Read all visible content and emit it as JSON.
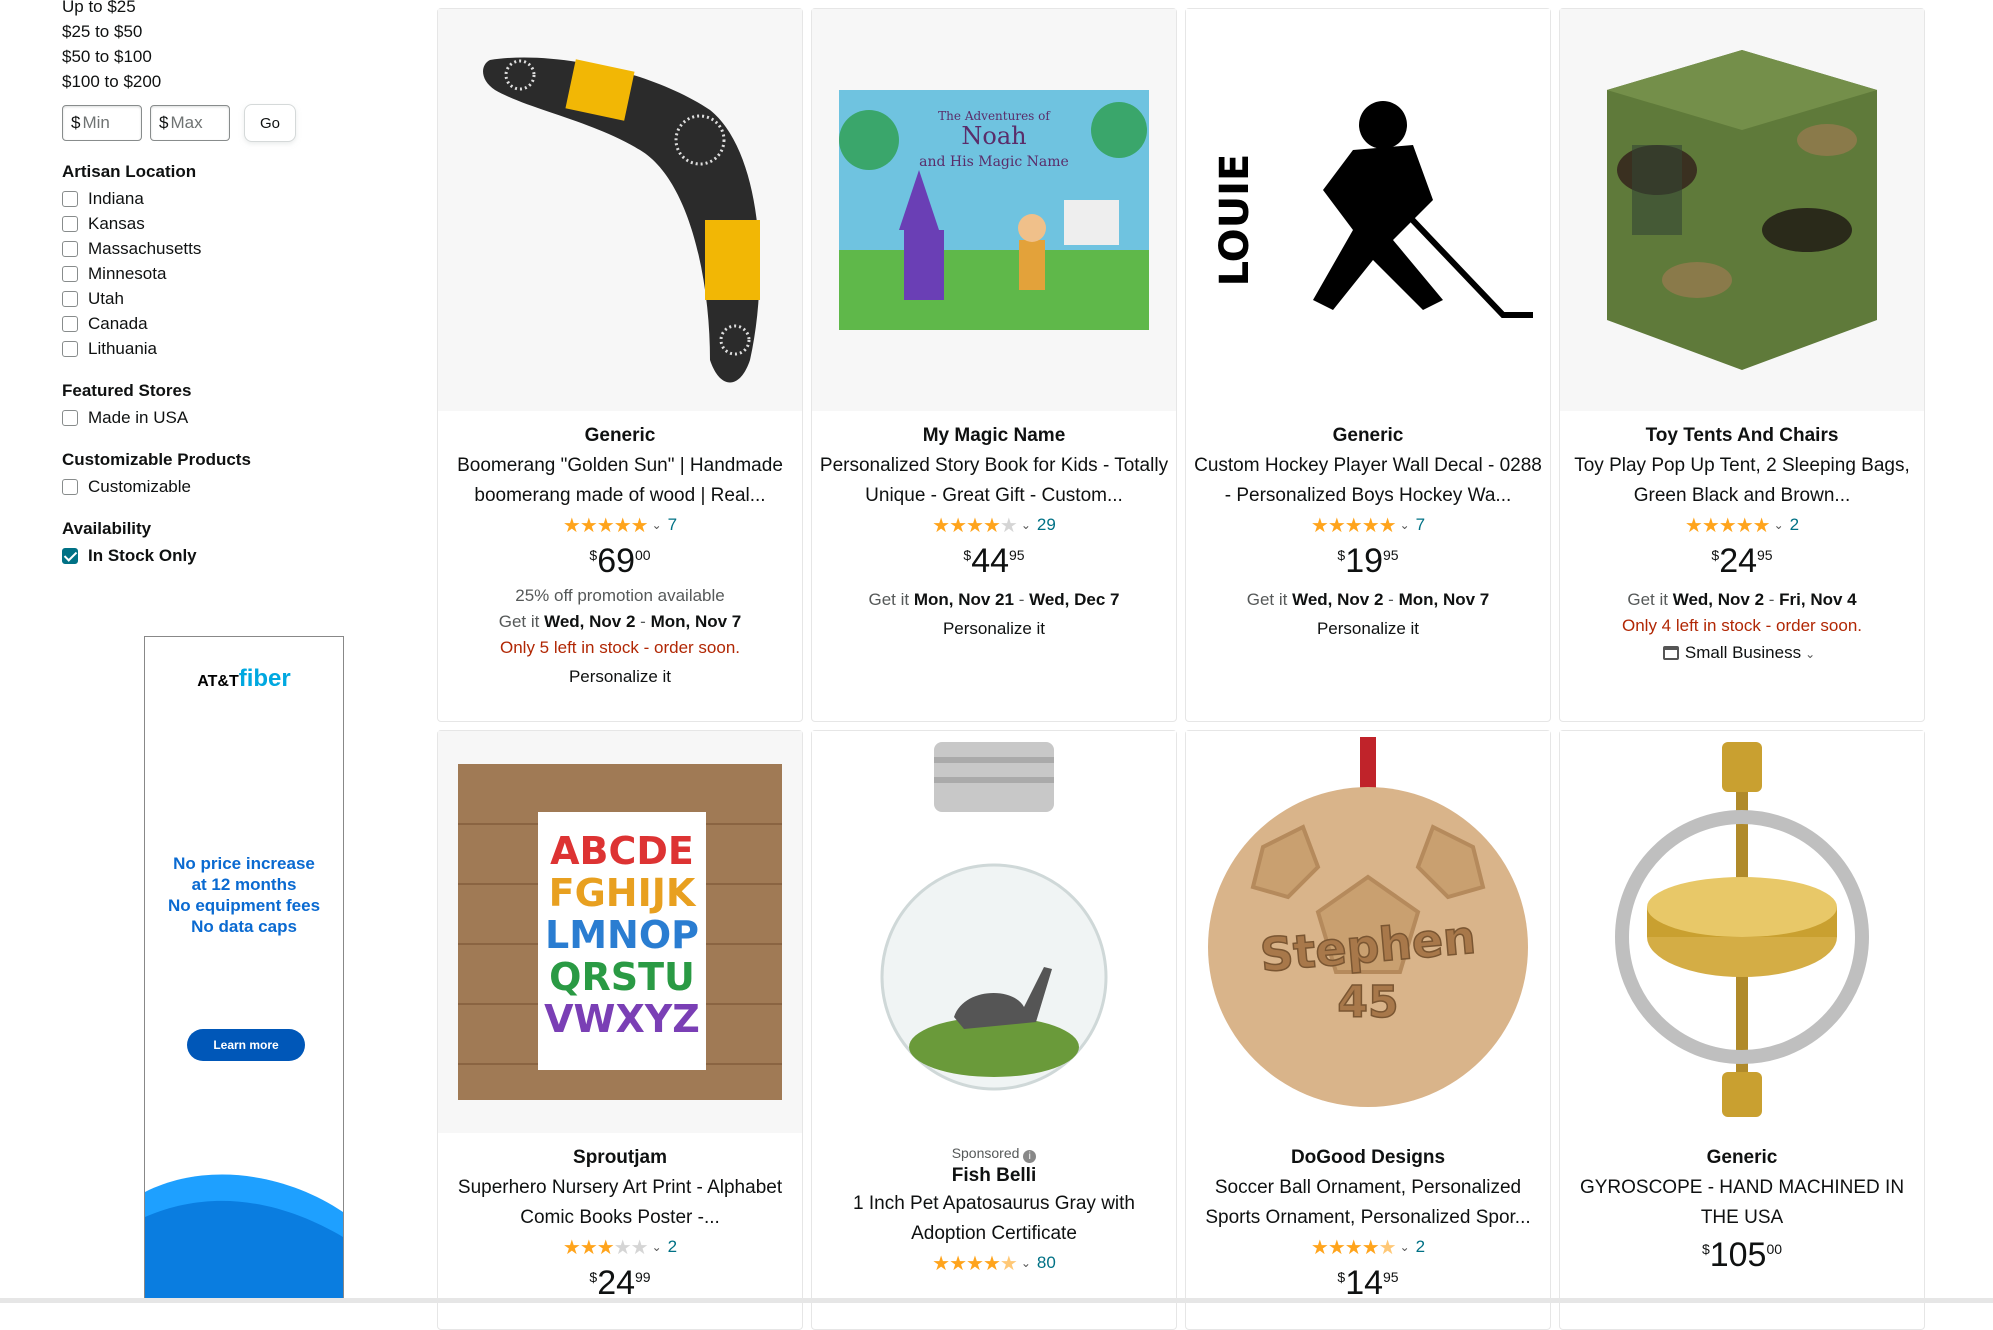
{
  "sidebar": {
    "price_links": [
      "Up to $25",
      "$25 to $50",
      "$50 to $100",
      "$100 to $200"
    ],
    "price_min": {
      "currency": "$",
      "placeholder": "Min"
    },
    "price_max": {
      "currency": "$",
      "placeholder": "Max"
    },
    "go_label": "Go",
    "artisan_location": {
      "heading": "Artisan Location",
      "items": [
        "Indiana",
        "Kansas",
        "Massachusetts",
        "Minnesota",
        "Utah",
        "Canada",
        "Lithuania"
      ]
    },
    "featured_stores": {
      "heading": "Featured Stores",
      "items": [
        "Made in USA"
      ]
    },
    "customizable": {
      "heading": "Customizable Products",
      "items": [
        "Customizable"
      ]
    },
    "availability": {
      "heading": "Availability",
      "items": [
        "In Stock Only"
      ],
      "checked": true
    }
  },
  "ad": {
    "logo_att": "AT&T",
    "logo_fiber": "fiber",
    "lines": [
      "No price increase",
      "at 12 months",
      "No equipment fees",
      "No data caps"
    ],
    "button": "Learn more"
  },
  "products": [
    {
      "brand": "Generic",
      "title": "Boomerang \"Golden Sun\" | Handmade boomerang made of wood | Real...",
      "rating": 5,
      "reviews": "7",
      "price_sym": "$",
      "price_whole": "69",
      "price_frac": "00",
      "promo": "25% off promotion available",
      "get_it": "Get it",
      "date_from": "Wed, Nov 2",
      "dash": "-",
      "date_to": "Mon, Nov 7",
      "stock": "Only 5 left in stock - order soon.",
      "personalize": "Personalize it",
      "image": "boomerang"
    },
    {
      "brand": "My Magic Name",
      "title": "Personalized Story Book for Kids - Totally Unique - Great Gift - Custom...",
      "rating": 4,
      "reviews": "29",
      "price_sym": "$",
      "price_whole": "44",
      "price_frac": "95",
      "get_it": "Get it",
      "date_from": "Mon, Nov 21",
      "dash": "-",
      "date_to": "Wed, Dec 7",
      "personalize": "Personalize it",
      "image": "book",
      "book_title_1": "The Adventures of",
      "book_title_2": "Noah",
      "book_title_3": "and His Magic Name"
    },
    {
      "brand": "Generic",
      "title": "Custom Hockey Player Wall Decal - 0288 - Personalized Boys Hockey Wa...",
      "rating": 5,
      "reviews": "7",
      "price_sym": "$",
      "price_whole": "19",
      "price_frac": "95",
      "get_it": "Get it",
      "date_from": "Wed, Nov 2",
      "dash": "-",
      "date_to": "Mon, Nov 7",
      "personalize": "Personalize it",
      "image": "hockey",
      "decal_name": "LOUIE"
    },
    {
      "brand": "Toy Tents And Chairs",
      "title": "Toy Play Pop Up Tent, 2 Sleeping Bags, Green Black and Brown...",
      "rating": 5,
      "reviews": "2",
      "price_sym": "$",
      "price_whole": "24",
      "price_frac": "95",
      "get_it": "Get it",
      "date_from": "Wed, Nov 2",
      "dash": "-",
      "date_to": "Fri, Nov 4",
      "stock": "Only 4 left in stock - order soon.",
      "small_business": "Small Business",
      "image": "tent"
    },
    {
      "brand": "Sproutjam",
      "title": "Superhero Nursery Art Print - Alphabet Comic Books Poster -...",
      "rating": 3,
      "reviews": "2",
      "price_sym": "$",
      "price_whole": "24",
      "price_frac": "99",
      "image": "alphabet",
      "poster_rows": [
        "ABCDE",
        "FGHIJK",
        "LMNOP",
        "QRSTU",
        "VWXYZ"
      ]
    },
    {
      "sponsored": "Sponsored",
      "brand": "Fish Belli",
      "title": "1 Inch Pet Apatosaurus Gray with Adoption Certificate",
      "rating": 4.5,
      "reviews": "80",
      "image": "jar"
    },
    {
      "brand": "DoGood Designs",
      "title": "Soccer Ball Ornament, Personalized Sports Ornament, Personalized Spor...",
      "rating": 4.5,
      "reviews": "2",
      "price_sym": "$",
      "price_whole": "14",
      "price_frac": "95",
      "image": "soccer",
      "ornament_name": "Stephen",
      "ornament_number": "45"
    },
    {
      "brand": "Generic",
      "title": "GYROSCOPE - HAND MACHINED IN THE USA",
      "price_sym": "$",
      "price_whole": "105",
      "price_frac": "00",
      "image": "gyro"
    }
  ]
}
